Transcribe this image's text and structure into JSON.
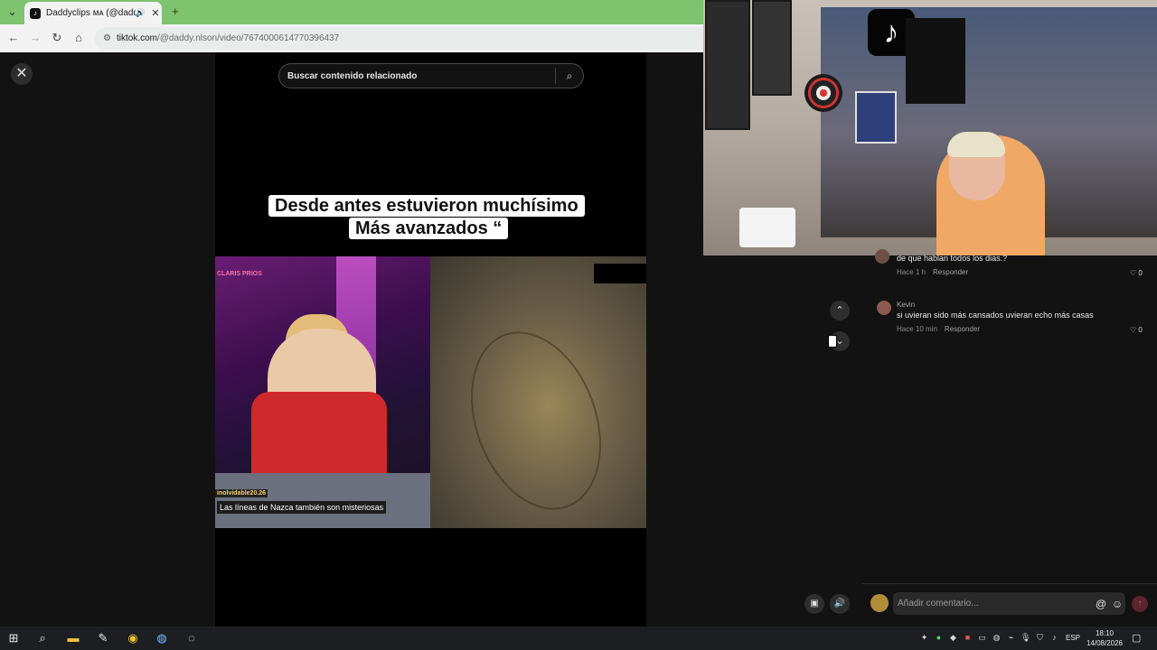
{
  "browser": {
    "tab_title": "Daddyclips ᴍᴀ (@daddy.nls",
    "tab_close": "✕",
    "new_tab": "+",
    "tab_list": "⌄",
    "url_host": "tiktok.com",
    "url_path": "/@daddy.nlson/video/7674000614770396437"
  },
  "video": {
    "search_placeholder": "Buscar contenido relacionado",
    "caption_line1": "Desde antes estuvieron muchísimo",
    "caption_line2": "Más avanzados “",
    "channel_logo": "CLARIS PRIOS",
    "overlay_handle": "inolvidable20.26",
    "overlay_subtitle": "Las líneas de Nazca también son misteriosas"
  },
  "comments": [
    {
      "name": "",
      "text": "de que hablan todos los dias.?",
      "time": "Hace 1 h",
      "reply_label": "Responder",
      "likes": "0"
    },
    {
      "name": "Kevin",
      "text": "si uvieran sido más cansados uvieran echo más casas",
      "time": "Hace 10 min",
      "reply_label": "Responder",
      "likes": "0"
    }
  ],
  "comment_input": {
    "placeholder": "Añadir comentario..."
  },
  "taskbar": {
    "lang": "ESP",
    "time": "18:10",
    "date": "14/08/2026"
  },
  "colors": {
    "tabstrip": "#7ec36e",
    "page_bg": "#121212",
    "send_button": "#5a2530"
  }
}
